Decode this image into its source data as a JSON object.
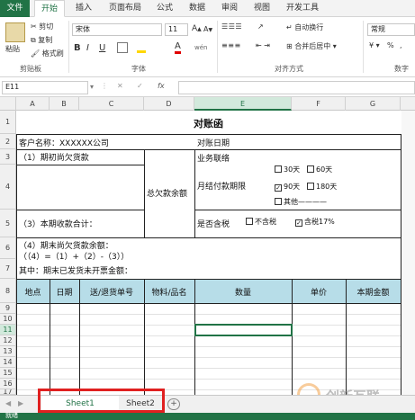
{
  "ribbon_tabs": [
    "文件",
    "开始",
    "插入",
    "页面布局",
    "公式",
    "数据",
    "审阅",
    "视图",
    "开发工具"
  ],
  "clipboard": {
    "paste": "粘贴",
    "cut": "剪切",
    "copy": "复制",
    "format_painter": "格式刷",
    "group": "剪贴板"
  },
  "font": {
    "name": "宋体",
    "size": "11",
    "group": "字体",
    "bold": "B",
    "italic": "I",
    "underline": "U",
    "grow": "A",
    "shrink": "A",
    "color_a": "A",
    "wen": "wén"
  },
  "alignment": {
    "wrap": "自动换行",
    "merge": "合并后居中",
    "group": "对齐方式"
  },
  "number": {
    "format": "常规",
    "group": "数字",
    "percent": "%"
  },
  "formula_bar": {
    "name_box": "E11",
    "fx": "fx",
    "value": ""
  },
  "columns": [
    "A",
    "B",
    "C",
    "D",
    "E",
    "F",
    "G"
  ],
  "rows": [
    "1",
    "2",
    "3",
    "4",
    "5",
    "6",
    "7",
    "8",
    "9",
    "10",
    "11",
    "12",
    "13",
    "14",
    "15",
    "16",
    "17"
  ],
  "sheet": {
    "title": "对账函",
    "customer": "客户名称：XXXXXX公司",
    "reconcile_date": "对账日期",
    "opening_unpaid": "（1）期初尚欠货款",
    "total_owed": "总欠款余额",
    "business_contact": "业务联络",
    "monthly_terms": "月结付款期限",
    "opt_30": "30天",
    "opt_60": "60天",
    "opt_90": "90天",
    "opt_180": "180天",
    "opt_other": "其他————",
    "collected": "（3）本期收款合计：",
    "tax_included": "是否含税",
    "no_tax": "不含税",
    "with_tax": "含税17%",
    "closing_unpaid": "（4）期末尚欠货款余额：",
    "formula": "（（4）=（1）+（2）-（3））",
    "not_invoiced": "其中：期末已发货未开票金额：",
    "hdr_location": "地点",
    "hdr_date": "日期",
    "hdr_order": "送/退货单号",
    "hdr_item": "物料/品名",
    "hdr_qty": "数量",
    "hdr_price": "单价",
    "hdr_amount": "本期金额"
  },
  "sheet_tabs": [
    "Sheet1",
    "Sheet2"
  ],
  "watermark": "创新互联",
  "status_ready": "就绪"
}
